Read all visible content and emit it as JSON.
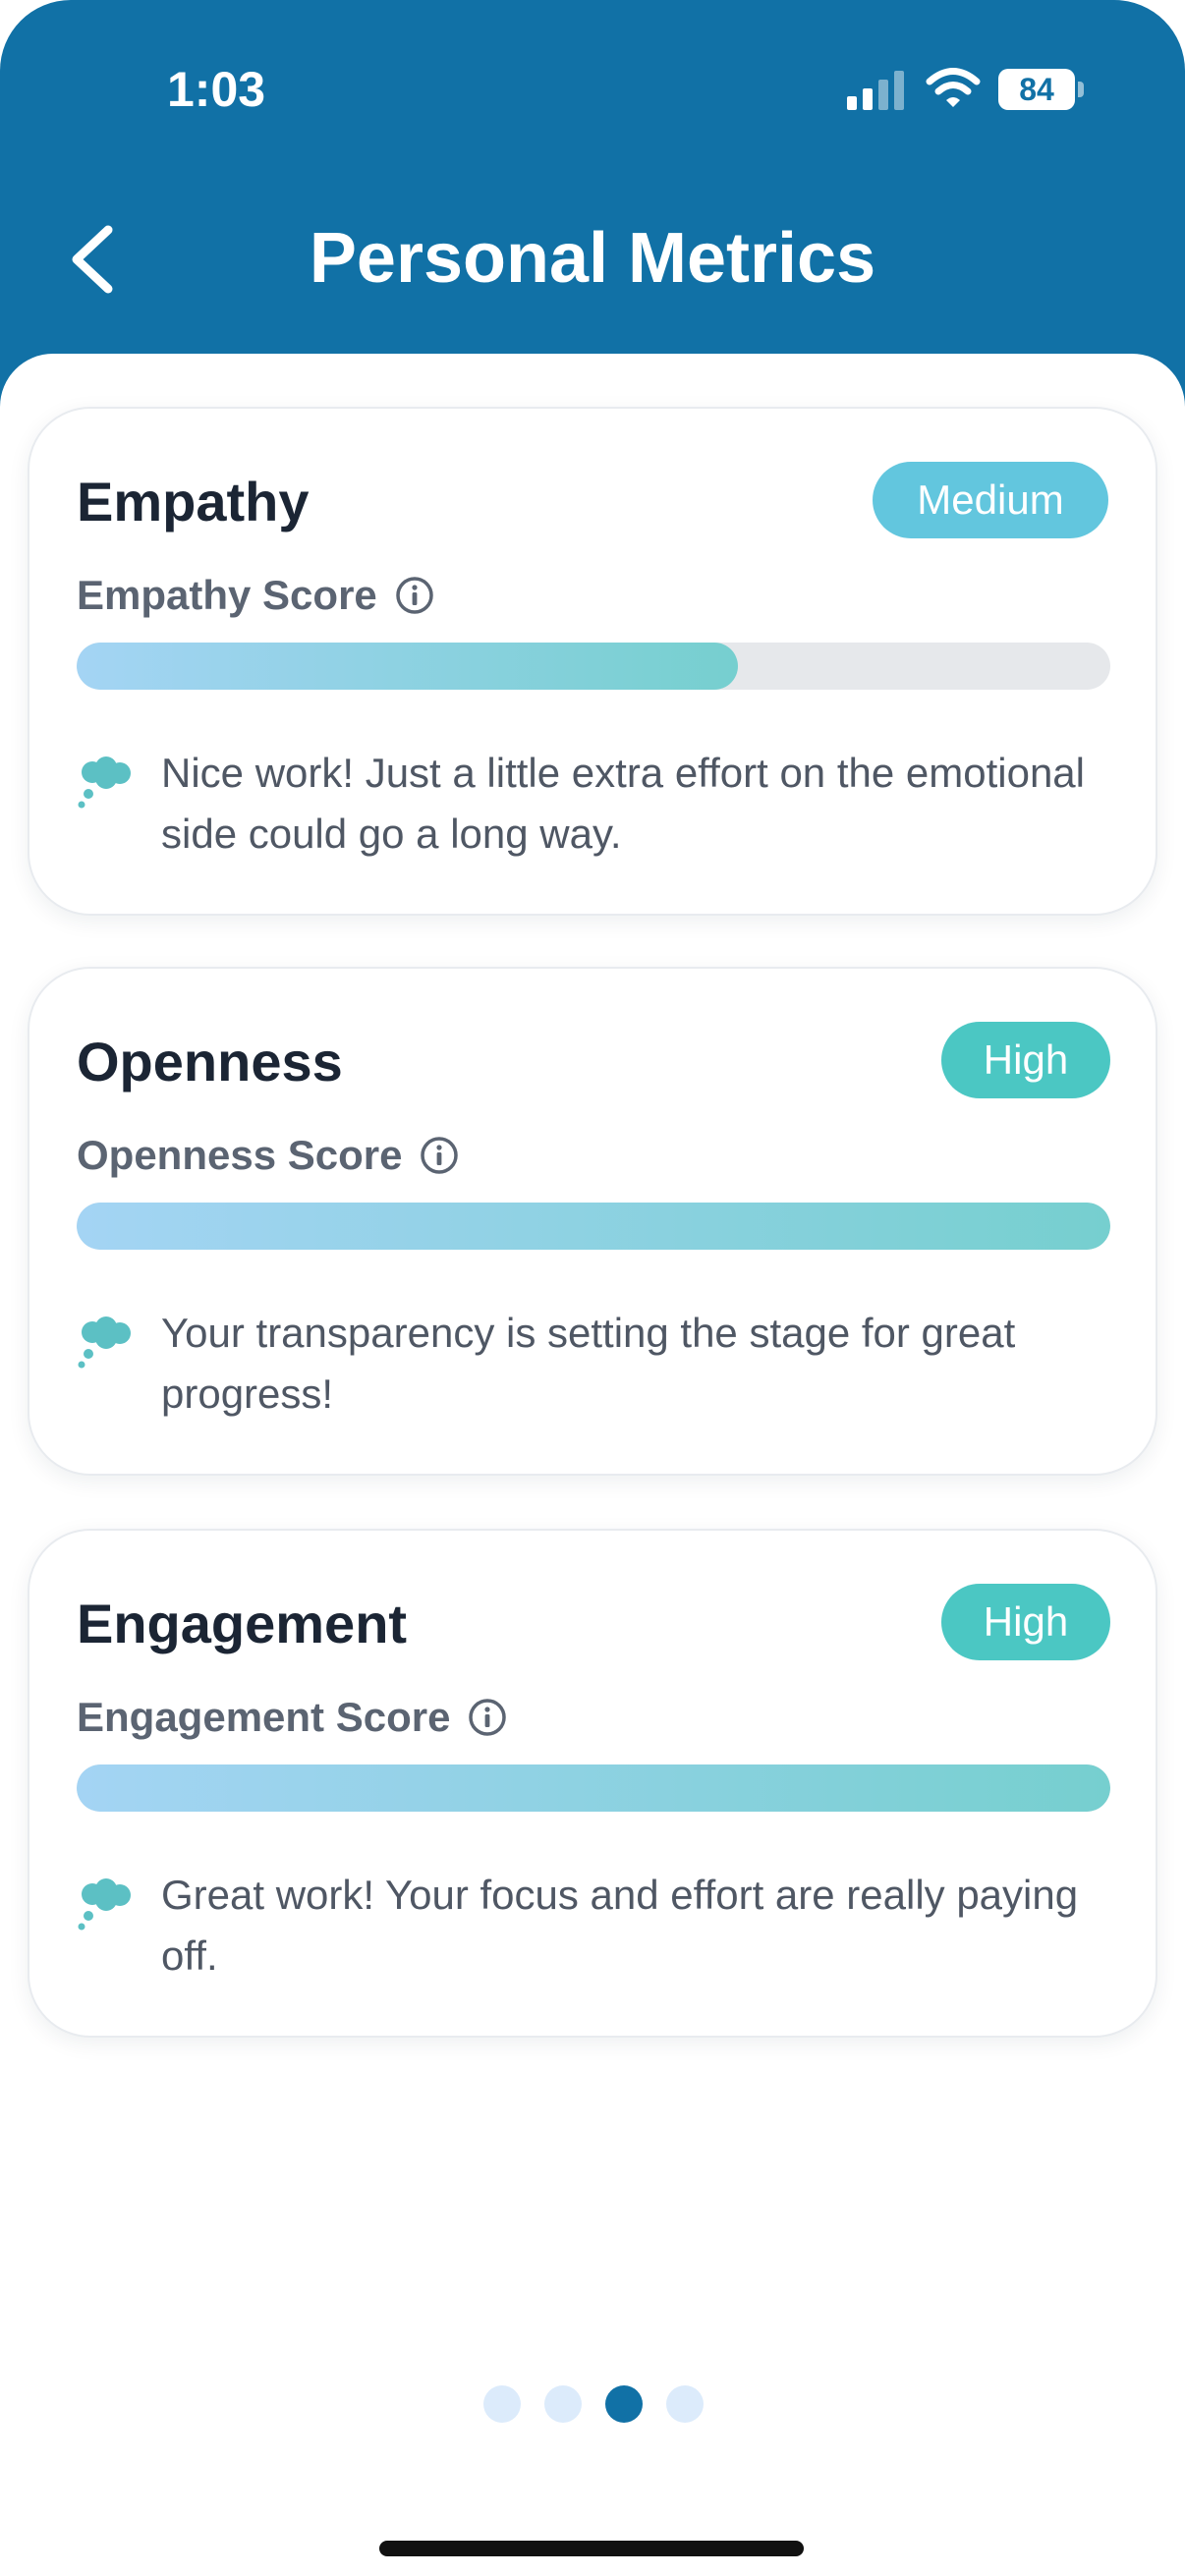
{
  "status_bar": {
    "time": "1:03",
    "battery": "84"
  },
  "header": {
    "title": "Personal Metrics"
  },
  "metrics": [
    {
      "title": "Empathy",
      "level": "Medium",
      "score_label": "Empathy Score",
      "score_fraction": 0.64,
      "note": "Nice work! Just a little extra effort on the emotional side could go a long way."
    },
    {
      "title": "Openness",
      "level": "High",
      "score_label": "Openness Score",
      "score_fraction": 1.0,
      "note": "Your transparency is setting the stage for great progress!"
    },
    {
      "title": "Engagement",
      "level": "High",
      "score_label": "Engagement Score",
      "score_fraction": 1.0,
      "note": "Great work! Your focus and effort are really paying off."
    }
  ],
  "pagination": {
    "count": 4,
    "active_index": 2
  },
  "colors": {
    "header": "#1171a6",
    "badge_medium": "#62c6de",
    "badge_high": "#4bc7c3",
    "fill_start": "#a4d4f4",
    "fill_end": "#76cfcf"
  },
  "icons": {
    "back": "chevron-left-icon",
    "info": "info-icon",
    "note": "thought-bubble-icon"
  }
}
